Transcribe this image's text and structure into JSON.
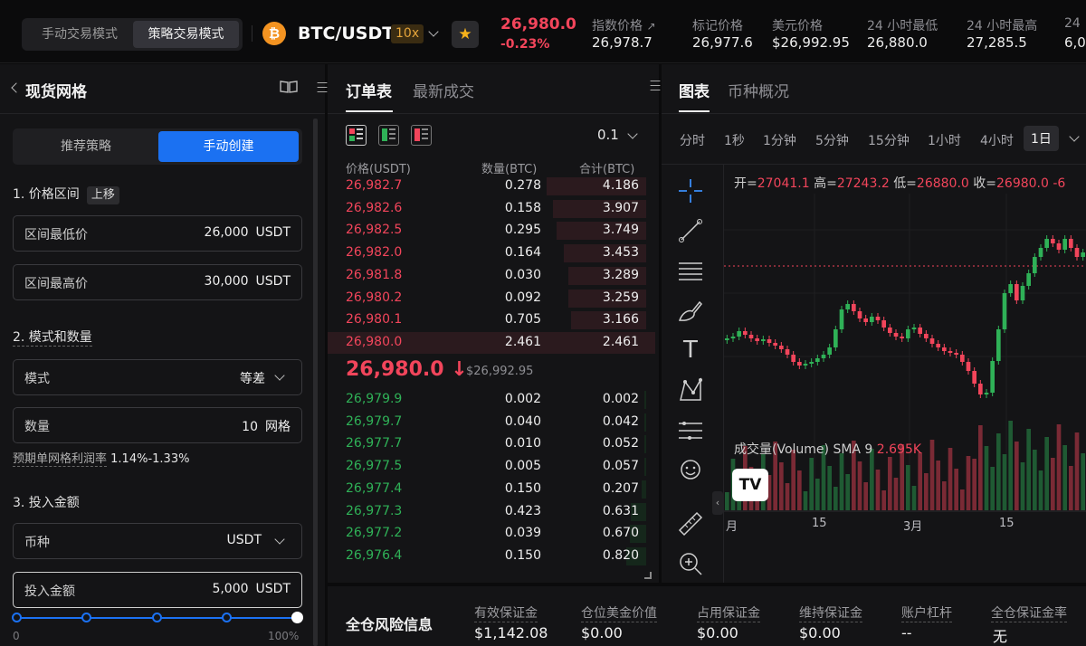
{
  "header": {
    "mode_manual": "手动交易模式",
    "mode_strategy": "策略交易模式",
    "pair": "BTC/USDT",
    "coin_glyph": "₿",
    "leverage": "10x",
    "last_price": "26,980.0",
    "change": "-0.23%",
    "stats": [
      {
        "label": "指数价格",
        "value": "26,978.7"
      },
      {
        "label": "标记价格",
        "value": "26,977.6"
      },
      {
        "label": "美元价格",
        "value": "$26,992.95"
      },
      {
        "label": "24 小时最低",
        "value": "26,880.0"
      },
      {
        "label": "24 小时最高",
        "value": "27,285.5"
      },
      {
        "label": "24",
        "value": "6,0"
      }
    ]
  },
  "left": {
    "title": "现货网格",
    "tab_recommend": "推荐策略",
    "tab_manual": "手动创建",
    "sec1": "1. 价格区间",
    "sec1_badge": "上移",
    "low_label": "区间最低价",
    "low_value": "26,000",
    "high_label": "区间最高价",
    "high_value": "30,000",
    "unit_usdt": "USDT",
    "sec2": "2. 模式和数量",
    "mode_label": "模式",
    "mode_value": "等差",
    "qty_label": "数量",
    "qty_value": "10",
    "qty_unit": "网格",
    "profit_label": "预期单网格利润率",
    "profit_value": "1.14%-1.33%",
    "sec3": "3. 投入金额",
    "currency_label": "币种",
    "currency_value": "USDT",
    "amount_label": "投入金额",
    "amount_value": "5,000",
    "slider_value_pct": 100,
    "slider_min": "0",
    "slider_max": "100%"
  },
  "orderbook": {
    "tab_book": "订单表",
    "tab_trades": "最新成交",
    "precision": "0.1",
    "col_price": "价格(USDT)",
    "col_qty": "数量(BTC)",
    "col_total": "合计(BTC)",
    "asks": [
      {
        "price": "26,982.7",
        "qty": "0.278",
        "total": "4.186"
      },
      {
        "price": "26,982.6",
        "qty": "0.158",
        "total": "3.907"
      },
      {
        "price": "26,982.5",
        "qty": "0.295",
        "total": "3.749"
      },
      {
        "price": "26,982.0",
        "qty": "0.164",
        "total": "3.453"
      },
      {
        "price": "26,981.8",
        "qty": "0.030",
        "total": "3.289"
      },
      {
        "price": "26,980.2",
        "qty": "0.092",
        "total": "3.259"
      },
      {
        "price": "26,980.1",
        "qty": "0.705",
        "total": "3.166"
      },
      {
        "price": "26,980.0",
        "qty": "2.461",
        "total": "2.461"
      }
    ],
    "mid_price": "26,980.0",
    "mid_arrow": "↓",
    "mid_usd": "$26,992.95",
    "bids": [
      {
        "price": "26,979.9",
        "qty": "0.002",
        "total": "0.002"
      },
      {
        "price": "26,979.7",
        "qty": "0.040",
        "total": "0.042"
      },
      {
        "price": "26,977.7",
        "qty": "0.010",
        "total": "0.052"
      },
      {
        "price": "26,977.5",
        "qty": "0.005",
        "total": "0.057"
      },
      {
        "price": "26,977.4",
        "qty": "0.150",
        "total": "0.207"
      },
      {
        "price": "26,977.3",
        "qty": "0.423",
        "total": "0.631"
      },
      {
        "price": "26,977.2",
        "qty": "0.039",
        "total": "0.670"
      },
      {
        "price": "26,976.4",
        "qty": "0.150",
        "total": "0.820"
      }
    ]
  },
  "chart": {
    "tab_chart": "图表",
    "tab_overview": "币种概况",
    "timeframes": [
      "分时",
      "1秒",
      "1分钟",
      "5分钟",
      "15分钟",
      "1小时",
      "4小时",
      "1日"
    ],
    "active_tf": "1日",
    "ohlc": [
      {
        "k": "开=",
        "v": "27041.1"
      },
      {
        "k": "高=",
        "v": "27243.2"
      },
      {
        "k": "低=",
        "v": "26880.0"
      },
      {
        "k": "收=",
        "v": "26980.0"
      }
    ],
    "ohlc_tail": "-6",
    "volume_label": "成交量(Volume) SMA 9",
    "volume_value": "2.695K",
    "x_labels": [
      "月",
      "15",
      "3月",
      "15"
    ],
    "watermark": "TV"
  },
  "risk": {
    "title": "全仓风险信息",
    "items": [
      {
        "label": "有效保证金",
        "value": "$1,142.08"
      },
      {
        "label": "仓位美金价值",
        "value": "$0.00"
      },
      {
        "label": "占用保证金",
        "value": "$0.00"
      },
      {
        "label": "维持保证金",
        "value": "$0.00"
      },
      {
        "label": "账户杠杆",
        "value": "--"
      },
      {
        "label": "全仓保证金率",
        "value": "无"
      }
    ]
  },
  "colors": {
    "up": "#2fb157",
    "down": "#f2455b",
    "accent": "#1b71f2",
    "brand_coin": "#f39321"
  }
}
